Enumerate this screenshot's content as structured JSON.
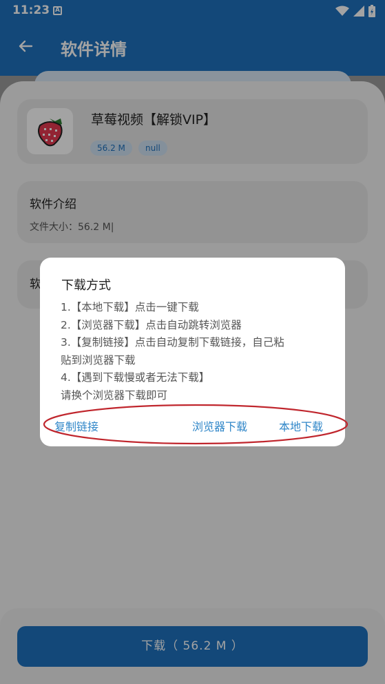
{
  "status_bar": {
    "time": "11:23",
    "notification_icon_letter": "A"
  },
  "app_bar": {
    "title": "软件详情"
  },
  "app_card": {
    "name": "草莓视频【解锁VIP】",
    "tags": [
      "56.2 M",
      "null"
    ]
  },
  "intro_card": {
    "title": "软件介绍",
    "file_size": "文件大小：56.2 M|"
  },
  "second_card": {
    "title": "软"
  },
  "dialog": {
    "title": "下载方式",
    "lines": [
      "1.【本地下载】点击一键下载",
      "2.【浏览器下载】点击自动跳转浏览器",
      "3.【复制链接】点击自动复制下载链接，自己粘",
      "贴到浏览器下载",
      "4.【遇到下载慢或者无法下载】",
      "请换个浏览器下载即可"
    ],
    "buttons": {
      "copy_link": "复制链接",
      "browser_download": "浏览器下载",
      "local_download": "本地下载"
    }
  },
  "download_button": {
    "label": "下载（ 56.2 M ）"
  },
  "colors": {
    "primary": "#1e71bd",
    "dialog_button_text": "#2f86c8",
    "annotation": "#c0262d",
    "tag_bg": "#cfe1f2"
  }
}
